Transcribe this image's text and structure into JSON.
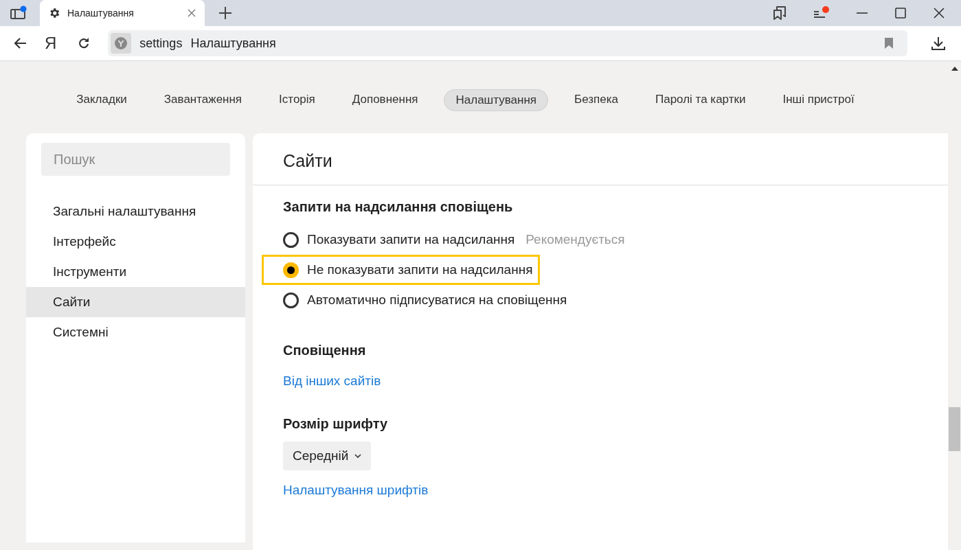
{
  "browser": {
    "tab_title": "Налаштування",
    "address_prefix": "settings",
    "address_title": "Налаштування",
    "logo_letter": "Я"
  },
  "nav_tabs": [
    {
      "label": "Закладки",
      "selected": false
    },
    {
      "label": "Завантаження",
      "selected": false
    },
    {
      "label": "Історія",
      "selected": false
    },
    {
      "label": "Доповнення",
      "selected": false
    },
    {
      "label": "Налаштування",
      "selected": true
    },
    {
      "label": "Безпека",
      "selected": false
    },
    {
      "label": "Паролі та картки",
      "selected": false
    },
    {
      "label": "Інші пристрої",
      "selected": false
    }
  ],
  "sidebar": {
    "search": {
      "placeholder": "Пошук"
    },
    "items": [
      {
        "label": "Загальні налаштування",
        "selected": false
      },
      {
        "label": "Інтерфейс",
        "selected": false
      },
      {
        "label": "Інструменти",
        "selected": false
      },
      {
        "label": "Сайти",
        "selected": true
      },
      {
        "label": "Системні",
        "selected": false
      }
    ]
  },
  "content": {
    "title": "Сайти",
    "sections": [
      {
        "heading": "Запити на надсилання сповіщень",
        "kind": "radios",
        "options": [
          {
            "label": "Показувати запити на надсилання",
            "note": "Рекомендується",
            "selected": false,
            "highlighted": false
          },
          {
            "label": "Не показувати запити на надсилання",
            "selected": true,
            "highlighted": true
          },
          {
            "label": "Автоматично підписуватися на сповіщення",
            "selected": false,
            "highlighted": false
          }
        ]
      },
      {
        "heading": "Сповіщення",
        "kind": "links",
        "links": [
          "Від інших сайтів"
        ]
      },
      {
        "heading": "Розмір шрифту",
        "kind": "select",
        "value": "Середній",
        "links": [
          "Налаштування шрифтів"
        ]
      }
    ]
  }
}
